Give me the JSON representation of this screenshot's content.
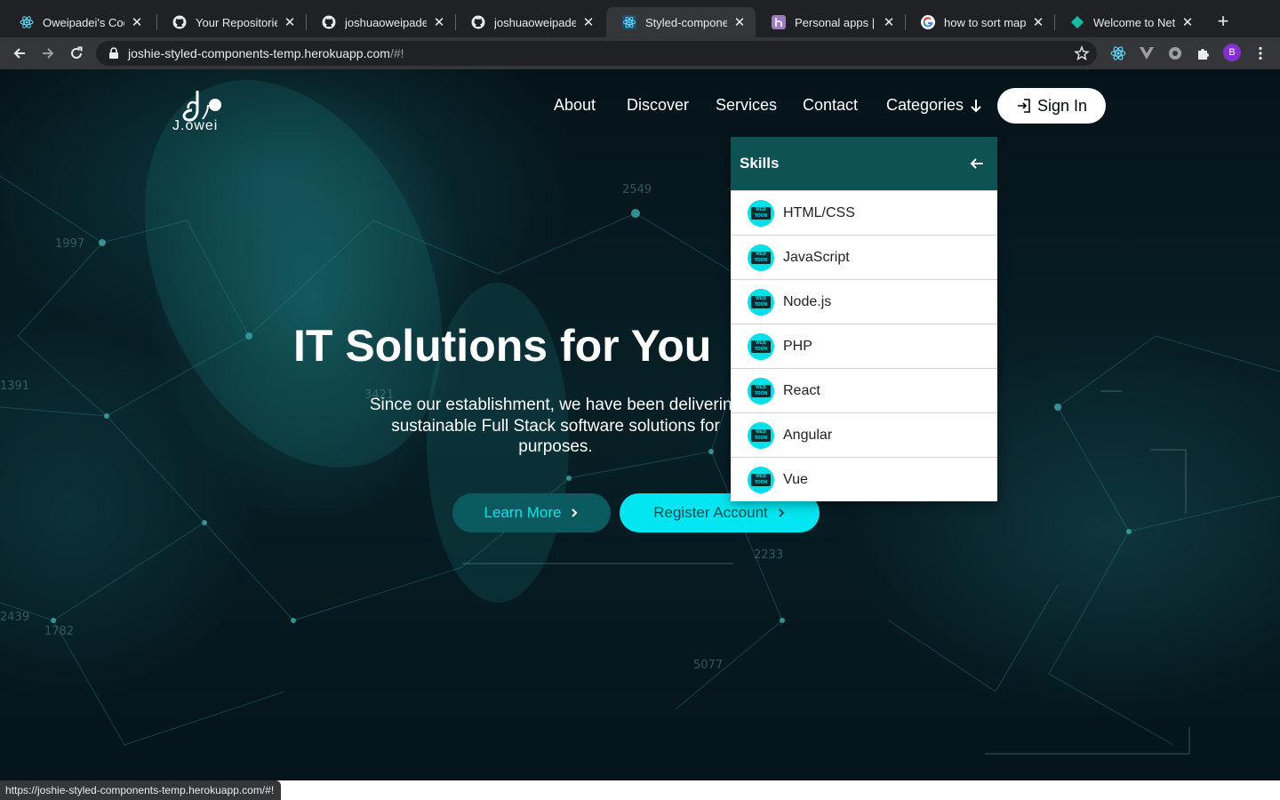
{
  "browser": {
    "tabs": [
      {
        "title": "Oweipadei's Code",
        "icon": "react-icon",
        "active": false
      },
      {
        "title": "Your Repositories",
        "icon": "github-icon",
        "active": false
      },
      {
        "title": "joshuaoweipadei/r",
        "icon": "github-icon",
        "active": false
      },
      {
        "title": "joshuaoweipadei/s",
        "icon": "github-icon",
        "active": false
      },
      {
        "title": "Styled-component",
        "icon": "react-icon",
        "active": true
      },
      {
        "title": "Personal apps | He",
        "icon": "heroku-icon",
        "active": false
      },
      {
        "title": "how to sort map a",
        "icon": "google-icon",
        "active": false
      },
      {
        "title": "Welcome to Netlify",
        "icon": "netlify-icon",
        "active": false
      }
    ],
    "url_host": "joshie-styled-components-temp.herokuapp.com",
    "url_path": "/#!",
    "profile_initial": "B",
    "status_url": "https://joshie-styled-components-temp.herokuapp.com/#!"
  },
  "site": {
    "logo_text": "J.owei",
    "nav": {
      "about": "About",
      "discover": "Discover",
      "services": "Services",
      "contact": "Contact",
      "categories": "Categories",
      "signin": "Sign In"
    },
    "hero": {
      "title": "IT Solutions for You",
      "text": "Since our establishment, we have been delivering sustainable Full Stack software solutions for purposes.",
      "learn_more": "Learn More",
      "register": "Register Account"
    },
    "dropdown": {
      "title": "Skills",
      "icon_label": "WEB TOON",
      "items": [
        "HTML/CSS",
        "JavaScript",
        "Node.js",
        "PHP",
        "React",
        "Angular",
        "Vue"
      ]
    }
  },
  "colors": {
    "accent": "#01e6f0",
    "dropdown_header": "#0e5253",
    "learn_bg": "#0b5a60"
  }
}
